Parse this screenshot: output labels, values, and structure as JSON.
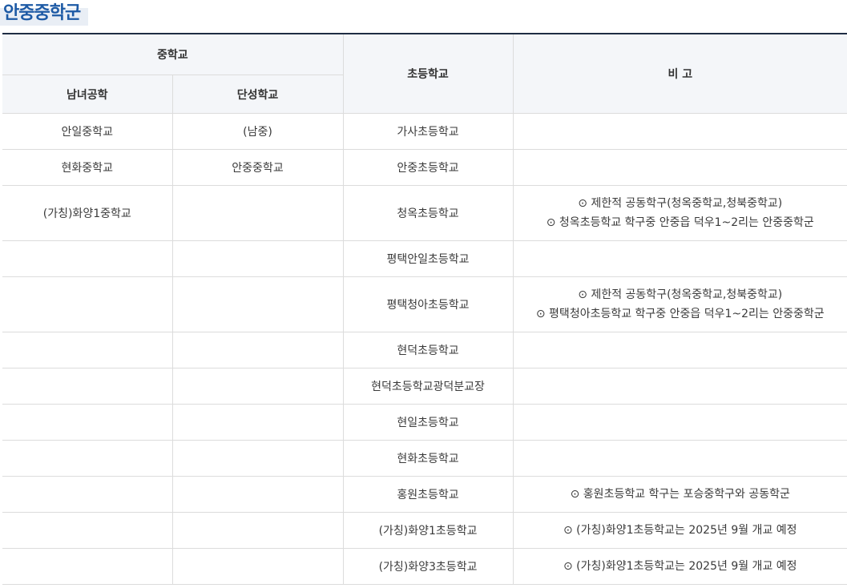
{
  "title": "안중중학군",
  "headers": {
    "middle_school": "중학교",
    "coed": "남녀공학",
    "single_sex": "단성학교",
    "elementary": "초등학교",
    "remarks": "비 고"
  },
  "rows": [
    {
      "coed": "안일중학교",
      "single": "(남중)",
      "elementary": "가사초등학교",
      "notes": []
    },
    {
      "coed": "현화중학교",
      "single": "안중중학교",
      "elementary": "안중초등학교",
      "notes": []
    },
    {
      "coed": "(가칭)화양1중학교",
      "single": "",
      "elementary": "청옥초등학교",
      "notes": [
        "⊙ 제한적 공동학구(청옥중학교,청북중학교)",
        "⊙ 청옥초등학교 학구중 안중읍 덕우1~2리는 안중중학군"
      ]
    },
    {
      "coed": "",
      "single": "",
      "elementary": "평택안일초등학교",
      "notes": []
    },
    {
      "coed": "",
      "single": "",
      "elementary": "평택청아초등학교",
      "notes": [
        "⊙ 제한적 공동학구(청옥중학교,청북중학교)",
        "⊙ 평택청아초등학교 학구중 안중읍 덕우1~2리는 안중중학군"
      ]
    },
    {
      "coed": "",
      "single": "",
      "elementary": "현덕초등학교",
      "notes": []
    },
    {
      "coed": "",
      "single": "",
      "elementary": "현덕초등학교광덕분교장",
      "notes": []
    },
    {
      "coed": "",
      "single": "",
      "elementary": "현일초등학교",
      "notes": []
    },
    {
      "coed": "",
      "single": "",
      "elementary": "현화초등학교",
      "notes": []
    },
    {
      "coed": "",
      "single": "",
      "elementary": "홍원초등학교",
      "notes": [
        "⊙ 홍원초등학교 학구는 포승중학구와 공동학군"
      ]
    },
    {
      "coed": "",
      "single": "",
      "elementary": "(가칭)화양1초등학교",
      "notes": [
        "⊙ (가칭)화양1초등학교는 2025년 9월 개교 예정"
      ]
    },
    {
      "coed": "",
      "single": "",
      "elementary": "(가칭)화양3초등학교",
      "notes": [
        "⊙ (가칭)화양1초등학교는 2025년 9월 개교 예정"
      ]
    }
  ]
}
